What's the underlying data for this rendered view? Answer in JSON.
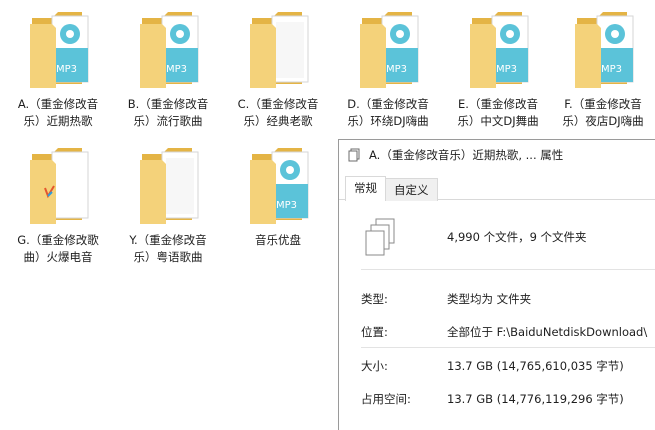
{
  "folders": [
    {
      "label": "A.（重金修改音\n乐）近期热歌",
      "icon": "folder-mp3-icon"
    },
    {
      "label": "B.（重金修改音\n乐）流行歌曲",
      "icon": "folder-mp3-icon"
    },
    {
      "label": "C.（重金修改音\n乐）经典老歌",
      "icon": "folder-plain-icon"
    },
    {
      "label": "D.（重金修改音\n乐）环绕DJ嗨曲",
      "icon": "folder-mp3-icon"
    },
    {
      "label": "E.（重金修改音\n乐）中文DJ舞曲",
      "icon": "folder-mp3-icon"
    },
    {
      "label": "F.（重金修改音\n乐）夜店DJ嗨曲",
      "icon": "folder-mp3-icon"
    },
    {
      "label": "G.（重金修改歌\n曲）火爆电音",
      "icon": "folder-doc-icon"
    },
    {
      "label": "Y.（重金修改音\n乐）粤语歌曲",
      "icon": "folder-plain-icon"
    },
    {
      "label": "音乐优盘",
      "icon": "folder-mp3-icon"
    }
  ],
  "dialog": {
    "title": "A.（重金修改音乐）近期热歌, ... 属性",
    "tabs": [
      "常规",
      "自定义"
    ],
    "summary": "4,990 个文件，9 个文件夹",
    "rows": [
      {
        "label": "类型:",
        "value": "类型均为 文件夹"
      },
      {
        "label": "位置:",
        "value": "全部位于 F:\\BaiduNetdiskDownload\\"
      },
      {
        "label": "大小:",
        "value": "13.7 GB (14,765,610,035 字节)"
      },
      {
        "label": "占用空间:",
        "value": "13.7 GB (14,776,119,296 字节)"
      }
    ]
  },
  "colors": {
    "folder_back": "#e8b84c",
    "folder_front": "#f5d57f",
    "mp3_accent": "#5bc3d9",
    "paper": "#ffffff"
  }
}
